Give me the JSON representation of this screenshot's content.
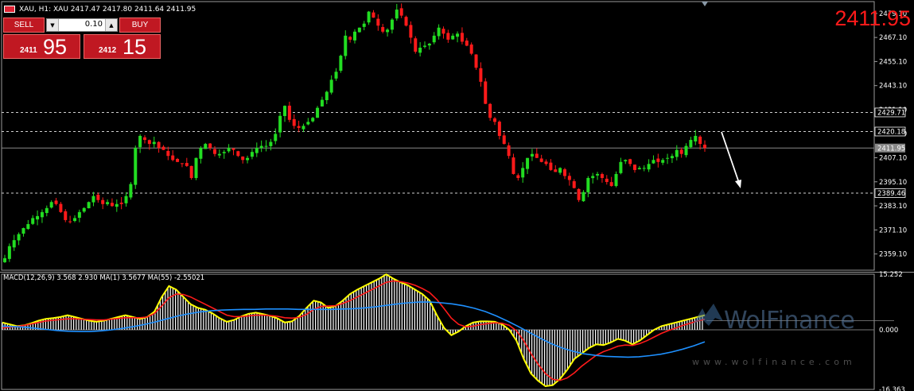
{
  "header": {
    "title": "XAU, H1:  XAU  2417.47 2417.80 2411.64 2411.95"
  },
  "current_price": "2411.95",
  "trade_panel": {
    "sell_label": "SELL",
    "buy_label": "BUY",
    "volume": "0.10",
    "volume_down_icon": "triangle-down-icon",
    "volume_up_icon": "triangle-up-icon",
    "sell_small": "2411",
    "sell_large": "95",
    "buy_small": "2412",
    "buy_large": "15"
  },
  "macd_label": "MACD(12,26,9) 3.568 2.930 MA(1) 3.5677 MA(55) -2.55021",
  "watermark": {
    "name": "WolFinance",
    "url": "www.wolfinance.com"
  },
  "colors": {
    "bull": "#22dd22",
    "bear": "#ff1a1a",
    "grid_dash": "#cfcfcf",
    "macd_signal": "#ff1a1a",
    "macd_ma1": "#ffff00",
    "macd_ma55": "#1e90ff",
    "price_highlight": "#ff1a1a"
  },
  "chart_data": {
    "type": "candlestick",
    "symbol": "XAU",
    "timeframe": "H1",
    "price_axis_ticks": [
      "2479.10",
      "2467.10",
      "2455.10",
      "2443.10",
      "2431.10",
      "2419.10",
      "2407.10",
      "2395.10",
      "2383.10",
      "2371.10",
      "2359.10"
    ],
    "price_ylim": [
      2351.0,
      2485.0
    ],
    "levels": [
      {
        "label": "2429.71",
        "value": 2429.71,
        "style": "dashed"
      },
      {
        "label": "2420.18",
        "value": 2420.18,
        "style": "dashed"
      },
      {
        "label": "2411.95",
        "value": 2411.95,
        "style": "solid"
      },
      {
        "label": "2389.46",
        "value": 2389.46,
        "style": "dashed"
      }
    ],
    "candles_close_path": [
      2357,
      2363,
      2366,
      2369,
      2372,
      2374,
      2377,
      2378,
      2380,
      2382,
      2385,
      2384,
      2380,
      2376,
      2375,
      2377,
      2380,
      2382,
      2385,
      2388,
      2386,
      2384,
      2385,
      2383,
      2384,
      2384,
      2388,
      2394,
      2412,
      2418,
      2416,
      2414,
      2415,
      2412,
      2411,
      2408,
      2406,
      2405,
      2404,
      2403,
      2397,
      2407,
      2412,
      2414,
      2412,
      2409,
      2409,
      2410,
      2412,
      2411,
      2408,
      2406,
      2407,
      2410,
      2412,
      2413,
      2413,
      2415,
      2419,
      2428,
      2433,
      2426,
      2423,
      2422,
      2423,
      2425,
      2427,
      2432,
      2436,
      2440,
      2446,
      2450,
      2458,
      2468,
      2466,
      2470,
      2472,
      2474,
      2480,
      2477,
      2473,
      2470,
      2471,
      2476,
      2481,
      2478,
      2473,
      2467,
      2460,
      2462,
      2463,
      2464,
      2468,
      2472,
      2469,
      2466,
      2468,
      2469,
      2465,
      2463,
      2459,
      2452,
      2445,
      2434,
      2427,
      2425,
      2418,
      2414,
      2408,
      2399,
      2397,
      2402,
      2407,
      2409,
      2407,
      2405,
      2404,
      2401,
      2400,
      2402,
      2398,
      2396,
      2392,
      2386,
      2390,
      2397,
      2398,
      2399,
      2397,
      2395,
      2393,
      2399,
      2405,
      2406,
      2404,
      2401,
      2402,
      2402,
      2404,
      2406,
      2405,
      2406,
      2407,
      2408,
      2411,
      2409,
      2413,
      2416,
      2418,
      2414,
      2411.95
    ],
    "macd_axis_ticks": [
      "15.252",
      "0.000",
      "-16.363"
    ],
    "macd_ylim": [
      -16.363,
      15.252
    ],
    "macd_histogram_path": [
      2,
      1.5,
      1,
      1.2,
      1.8,
      2.5,
      3,
      3.2,
      3.5,
      4,
      3.5,
      3,
      2.5,
      2.2,
      2.5,
      3,
      3.5,
      4,
      3.5,
      3,
      3.5,
      5,
      9,
      12,
      11,
      9,
      7,
      6,
      5.5,
      4.5,
      3.2,
      2.2,
      2.7,
      3.7,
      4.4,
      4.7,
      4.3,
      3.8,
      3.1,
      2,
      2.3,
      3.8,
      6,
      8,
      7.5,
      6,
      6.5,
      8,
      9.8,
      11,
      12,
      13,
      14,
      15.2,
      14,
      13,
      12.2,
      11,
      9.8,
      8,
      4,
      0.5,
      -1.5,
      -0.5,
      1,
      2,
      2.3,
      2.3,
      2.2,
      1.5,
      0,
      -3,
      -8,
      -12,
      -14,
      -15.5,
      -15.2,
      -13.5,
      -11,
      -8,
      -6.5,
      -5,
      -4,
      -4.2,
      -3.5,
      -2.5,
      -3,
      -4,
      -3,
      -1.5,
      0,
      1,
      1.5,
      2,
      2.5,
      3,
      3.5,
      4
    ],
    "macd_signal_path": [
      0.5,
      0.7,
      0.9,
      1.2,
      1.6,
      2,
      2.4,
      2.6,
      2.8,
      3,
      3,
      2.9,
      2.8,
      2.7,
      2.7,
      2.9,
      3.1,
      3.3,
      3.3,
      3.3,
      3.5,
      4.5,
      6.5,
      8.8,
      9.8,
      9.7,
      9,
      8,
      7,
      6,
      5,
      4,
      3.6,
      3.6,
      3.8,
      4,
      4,
      3.9,
      3.7,
      3.3,
      3.2,
      3.4,
      4.2,
      5.6,
      6.4,
      6.5,
      6.6,
      7.2,
      8,
      9,
      10,
      11,
      12,
      13,
      13.4,
      13.2,
      12.8,
      12.2,
      11.3,
      10.2,
      8.3,
      5.8,
      3.2,
      1.5,
      0.8,
      1,
      1.4,
      1.7,
      1.9,
      1.8,
      1.2,
      -0.3,
      -3,
      -6.5,
      -9.5,
      -12,
      -13.6,
      -13.9,
      -13.2,
      -11.8,
      -10,
      -8.5,
      -7,
      -6,
      -5.3,
      -4.5,
      -4.2,
      -4.3,
      -3.8,
      -3,
      -2,
      -1,
      -0.2,
      0.5,
      1.2,
      1.8,
      2.4,
      2.9
    ],
    "macd_ma55_path": [
      1,
      0.9,
      0.7,
      0.4,
      0.1,
      -0.2,
      -0.4,
      -0.5,
      -0.5,
      -0.3,
      0,
      0.4,
      0.9,
      1.5,
      2.2,
      3,
      3.8,
      4.4,
      4.9,
      5.2,
      5.4,
      5.5,
      5.6,
      5.6,
      5.7,
      5.7,
      5.7,
      5.6,
      5.6,
      5.6,
      5.6,
      5.7,
      5.8,
      6,
      6.3,
      6.7,
      7.1,
      7.4,
      7.6,
      7.6,
      7.4,
      7.1,
      6.6,
      5.9,
      5,
      3.8,
      2.4,
      0.9,
      -0.7,
      -2.3,
      -3.8,
      -5,
      -5.9,
      -6.6,
      -7,
      -7.3,
      -7.4,
      -7.5,
      -7.4,
      -7.1,
      -6.7,
      -6.1,
      -5.3,
      -4.4,
      -3.3
    ]
  }
}
